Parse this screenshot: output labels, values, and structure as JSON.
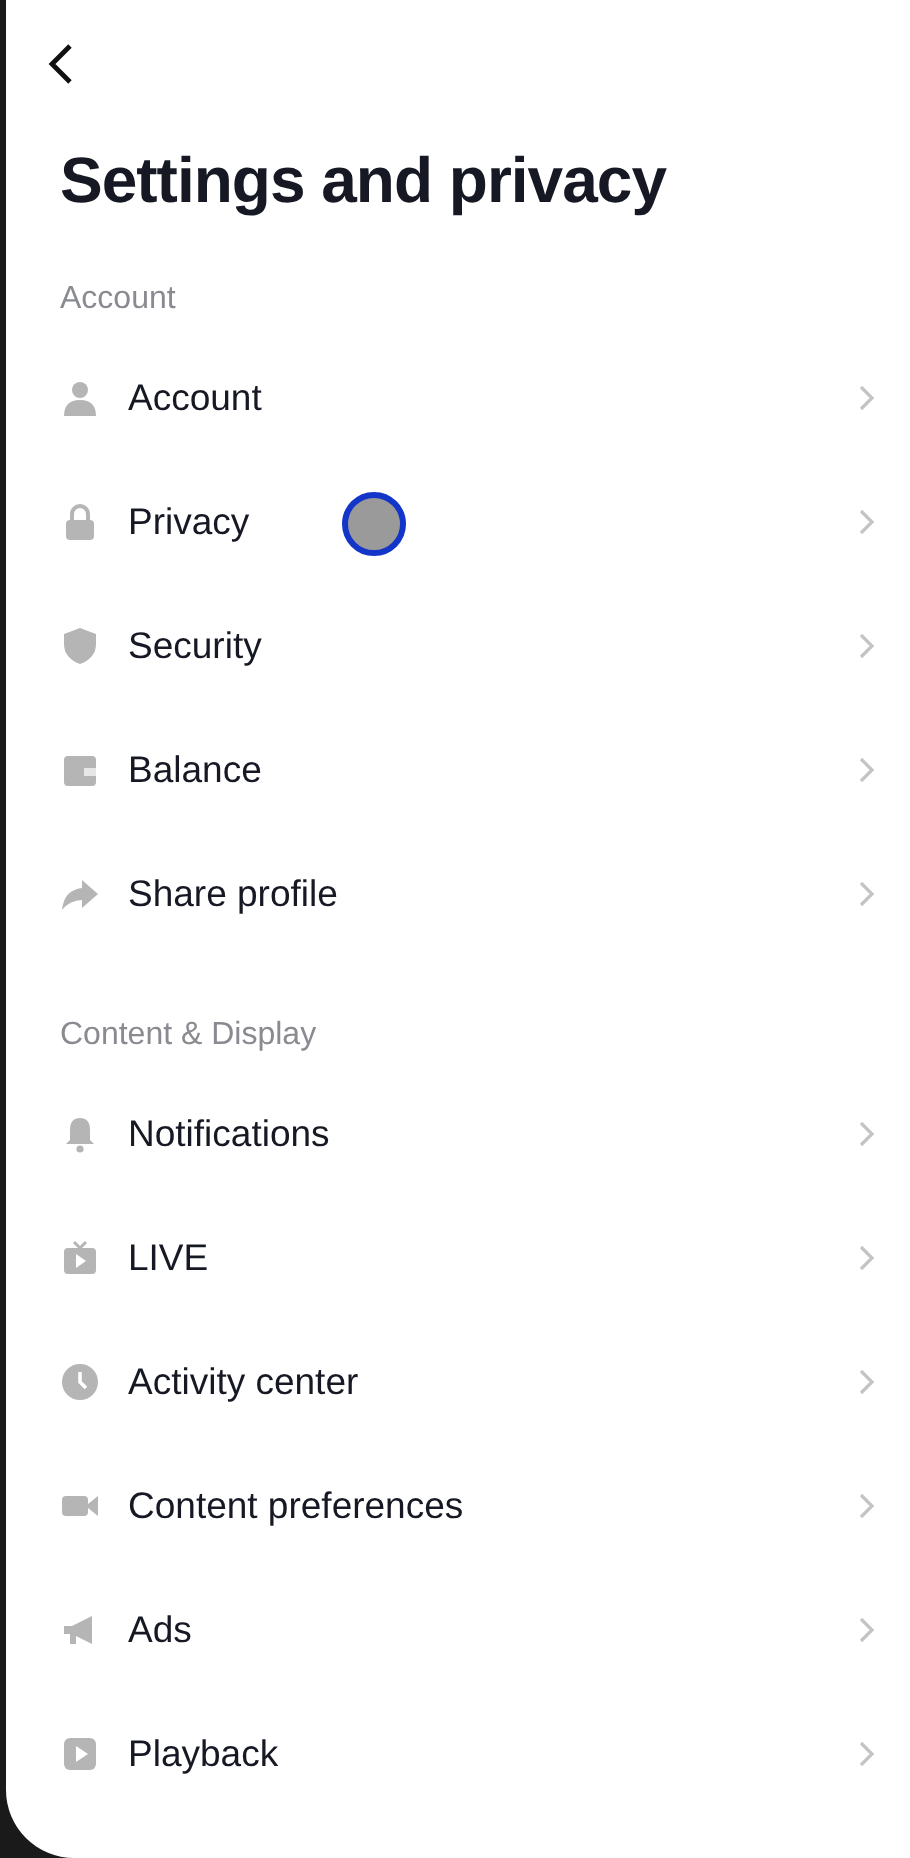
{
  "header": {
    "title": "Settings and privacy"
  },
  "sections": [
    {
      "heading": "Account",
      "items": [
        {
          "label": "Account"
        },
        {
          "label": "Privacy"
        },
        {
          "label": "Security"
        },
        {
          "label": "Balance"
        },
        {
          "label": "Share profile"
        }
      ]
    },
    {
      "heading": "Content & Display",
      "items": [
        {
          "label": "Notifications"
        },
        {
          "label": "LIVE"
        },
        {
          "label": "Activity center"
        },
        {
          "label": "Content preferences"
        },
        {
          "label": "Ads"
        },
        {
          "label": "Playback"
        }
      ]
    }
  ]
}
